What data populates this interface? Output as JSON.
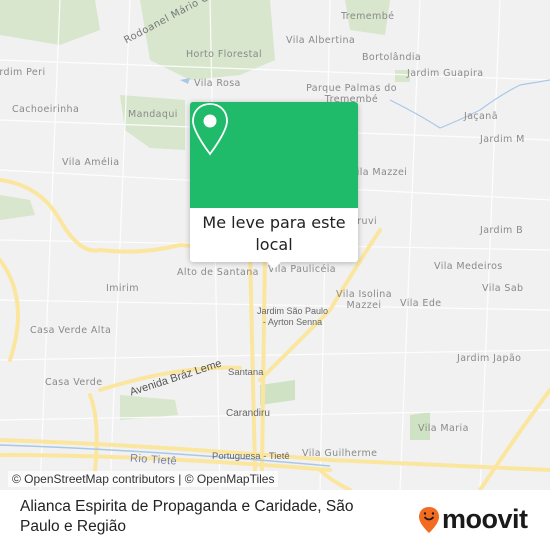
{
  "map": {
    "labels": [
      {
        "text": "Rodoanel Mário Covas"
      },
      {
        "text": "Tremembé"
      },
      {
        "text": "Vila Albertina"
      },
      {
        "text": "Horto Florestal"
      },
      {
        "text": "Bortolândia"
      },
      {
        "text": "Jardim Peri"
      },
      {
        "text": "Jardim Guapira"
      },
      {
        "text": "Vila Rosa"
      },
      {
        "text": "Parque Palmas do Tremembé"
      },
      {
        "text": "Cachoeirinha"
      },
      {
        "text": "Mandaqui"
      },
      {
        "text": "Jaçanã"
      },
      {
        "text": "Jardim M"
      },
      {
        "text": "Vila Amélia"
      },
      {
        "text": "Vila Mazzei"
      },
      {
        "text": "Tucuruvi"
      },
      {
        "text": "Jardim B"
      },
      {
        "text": "Alto de Santana"
      },
      {
        "text": "Vila Paulicéia"
      },
      {
        "text": "Vila Medeiros"
      },
      {
        "text": "Imirim"
      },
      {
        "text": "Vila Isolina Mazzei"
      },
      {
        "text": "Vila Ede"
      },
      {
        "text": "Vila Sab"
      },
      {
        "text": "Jardim São Paulo - Ayrton Senna"
      },
      {
        "text": "Casa Verde Alta"
      },
      {
        "text": "Jardim Japão"
      },
      {
        "text": "Avenida Bráz Leme"
      },
      {
        "text": "Santana"
      },
      {
        "text": "Casa Verde"
      },
      {
        "text": "Carandiru"
      },
      {
        "text": "Vila Maria"
      },
      {
        "text": "Vila Guilherme"
      },
      {
        "text": "Portuguesa - Tietê"
      },
      {
        "text": "Rio Tietê"
      }
    ],
    "colors": {
      "park": "#d7e6cc",
      "road_major": "#fbe6a0",
      "water": "#a8c8e8",
      "accent": "#1fba6a"
    }
  },
  "popup": {
    "icon": "map-pin-icon",
    "label": "Me leve para este local"
  },
  "attribution": "© OpenStreetMap contributors | © OpenMapTiles",
  "footer": {
    "title": "Alianca Espirita de Propaganda e Caridade, São Paulo e Região",
    "logo_text": "moovit",
    "logo_color": "#f26b21"
  }
}
